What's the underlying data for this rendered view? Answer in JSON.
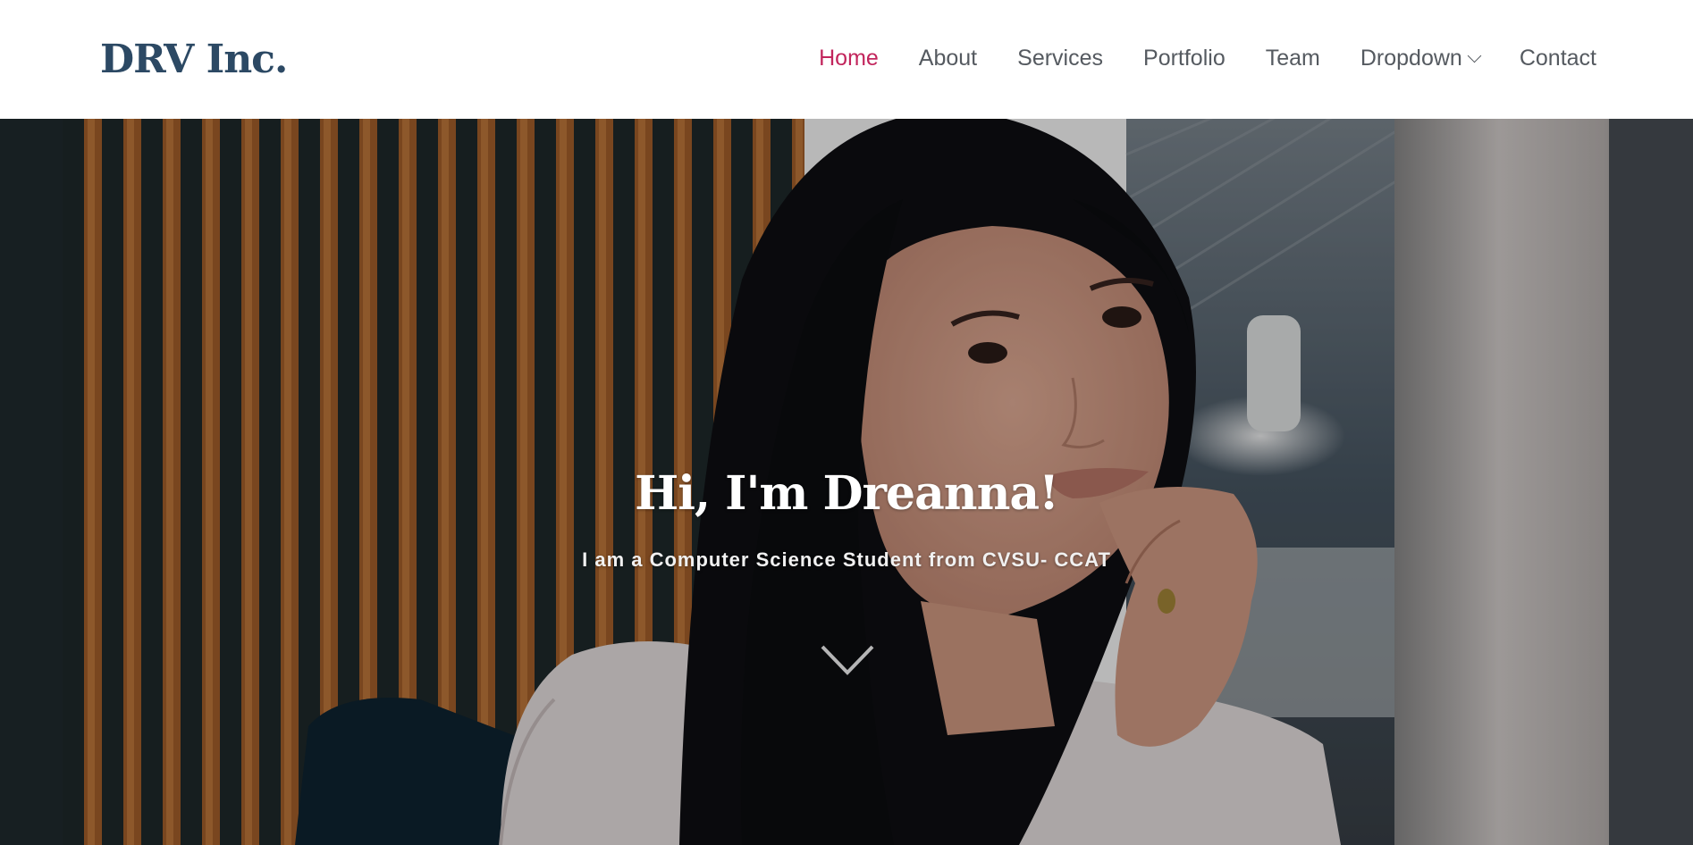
{
  "header": {
    "logo": "DRV Inc.",
    "nav": [
      {
        "label": "Home",
        "active": true
      },
      {
        "label": "About"
      },
      {
        "label": "Services"
      },
      {
        "label": "Portfolio"
      },
      {
        "label": "Team"
      },
      {
        "label": "Dropdown",
        "icon": "chevron-down-icon"
      },
      {
        "label": "Contact"
      }
    ]
  },
  "hero": {
    "title": "Hi, I'm Dreanna!",
    "subtitle": "I am a Computer Science Student from CVSU- CCAT",
    "scroll_icon": "chevron-down-icon"
  },
  "colors": {
    "brand": "#2c4964",
    "accent": "#c2255c",
    "nav_text": "#555a60"
  }
}
